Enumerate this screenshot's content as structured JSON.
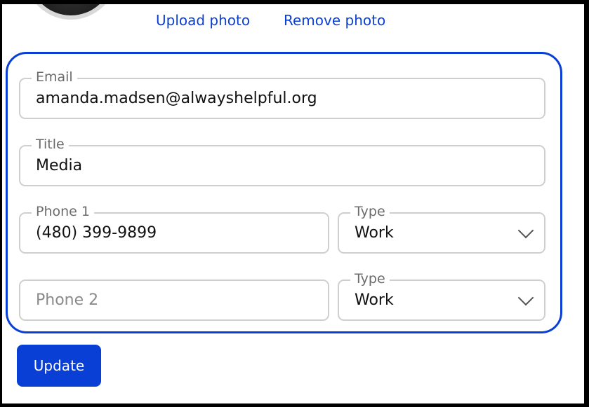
{
  "profile": {
    "upload_label": "Upload photo",
    "remove_label": "Remove photo"
  },
  "form": {
    "email": {
      "label": "Email",
      "value": "amanda.madsen@alwayshelpful.org"
    },
    "title": {
      "label": "Title",
      "value": "Media"
    },
    "phone1": {
      "label": "Phone 1",
      "value": "(480) 399-9899"
    },
    "phone1_type": {
      "label": "Type",
      "value": "Work"
    },
    "phone2": {
      "placeholder": "Phone 2"
    },
    "phone2_type": {
      "label": "Type",
      "value": "Work"
    }
  },
  "actions": {
    "update_label": "Update"
  },
  "colors": {
    "accent": "#0a3fd6",
    "field_border": "#cfcfcf"
  },
  "icons": {
    "dropdown": "chevron-down-icon"
  }
}
